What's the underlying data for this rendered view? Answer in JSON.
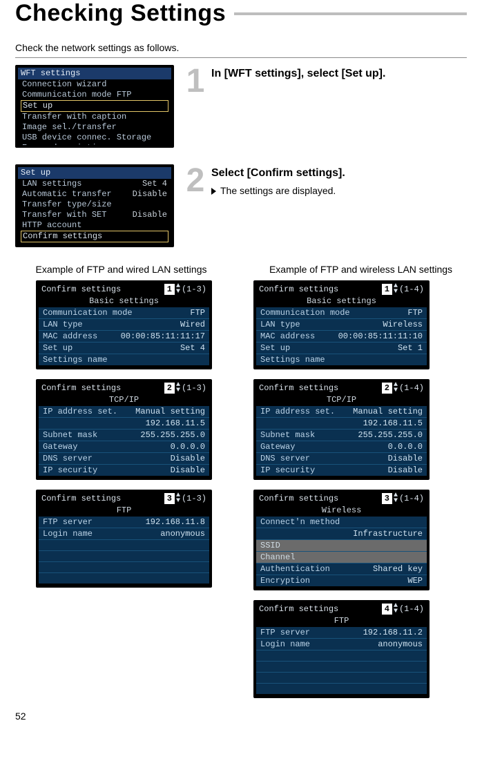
{
  "title": "Checking Settings",
  "intro": "Check the network settings as follows.",
  "page_number": "52",
  "step1": {
    "number": "1",
    "heading": "In [WFT settings], select [Set up].",
    "screen": {
      "header": "WFT settings",
      "rows": [
        "Connection wizard",
        "Communication mode FTP",
        "Set up",
        "Transfer with caption",
        "Image sel./transfer",
        "USB device connec. Storage",
        "Error description"
      ],
      "selected_index": 2,
      "muted_index": 6
    }
  },
  "step2": {
    "number": "2",
    "heading": "Select [Confirm settings].",
    "note": "The settings are displayed.",
    "screen": {
      "header": "Set up",
      "rows": [
        {
          "l": "LAN settings",
          "r": "Set 4"
        },
        {
          "l": "Automatic transfer",
          "r": "Disable"
        },
        {
          "l": "Transfer type/size",
          "r": ""
        },
        {
          "l": "Transfer with SET",
          "r": "Disable"
        },
        {
          "l": "HTTP account",
          "r": "",
          "muted": true
        },
        {
          "l": "Confirm settings",
          "r": "",
          "selected": true
        }
      ]
    }
  },
  "examples": {
    "wired_title": "Example of FTP and wired LAN settings",
    "wireless_title": "Example of FTP and wireless LAN settings",
    "wired": [
      {
        "title": "Confirm settings",
        "page": "1",
        "range": "(1-3)",
        "subtitle": "Basic settings",
        "rows": [
          {
            "l": "Communication mode",
            "r": "FTP"
          },
          {
            "l": "LAN type",
            "r": "Wired"
          },
          {
            "l": "MAC address",
            "r": "00:00:85:11:11:17"
          },
          {
            "l": "Set up",
            "r": "Set 4"
          },
          {
            "l": "Settings name",
            "r": ""
          }
        ],
        "pad": 0
      },
      {
        "title": "Confirm settings",
        "page": "2",
        "range": "(1-3)",
        "subtitle": "TCP/IP",
        "rows": [
          {
            "l": "IP address set.",
            "r": "Manual setting"
          },
          {
            "l": "_",
            "r": "192.168.11.5",
            "hide_label": true
          },
          {
            "l": "Subnet mask",
            "r": "255.255.255.0"
          },
          {
            "l": "Gateway",
            "r": "0.0.0.0"
          },
          {
            "l": "DNS server",
            "r": "Disable"
          },
          {
            "l": "IP security",
            "r": "Disable"
          }
        ],
        "pad": 0
      },
      {
        "title": "Confirm settings",
        "page": "3",
        "range": "(1-3)",
        "subtitle": "FTP",
        "rows": [
          {
            "l": "FTP server",
            "r": "192.168.11.8"
          },
          {
            "l": "Login name",
            "r": "anonymous"
          }
        ],
        "pad": 4
      }
    ],
    "wireless": [
      {
        "title": "Confirm settings",
        "page": "1",
        "range": "(1-4)",
        "subtitle": "Basic settings",
        "rows": [
          {
            "l": "Communication mode",
            "r": "FTP"
          },
          {
            "l": "LAN type",
            "r": "Wireless"
          },
          {
            "l": "MAC address",
            "r": "00:00:85:11:11:10"
          },
          {
            "l": "Set up",
            "r": "Set 1"
          },
          {
            "l": "Settings name",
            "r": ""
          }
        ],
        "pad": 0
      },
      {
        "title": "Confirm settings",
        "page": "2",
        "range": "(1-4)",
        "subtitle": "TCP/IP",
        "rows": [
          {
            "l": "IP address set.",
            "r": "Manual setting"
          },
          {
            "l": "_",
            "r": "192.168.11.5",
            "hide_label": true
          },
          {
            "l": "Subnet mask",
            "r": "255.255.255.0"
          },
          {
            "l": "Gateway",
            "r": "0.0.0.0"
          },
          {
            "l": "DNS server",
            "r": "Disable"
          },
          {
            "l": "IP security",
            "r": "Disable"
          }
        ],
        "pad": 0
      },
      {
        "title": "Confirm settings",
        "page": "3",
        "range": "(1-4)",
        "subtitle": "Wireless",
        "rows": [
          {
            "l": "Connect'n method",
            "r": ""
          },
          {
            "l": "_",
            "r": "Infrastructure",
            "hide_label": true
          },
          {
            "l": "SSID",
            "r": "",
            "grey": true
          },
          {
            "l": "Channel",
            "r": "",
            "grey": true
          },
          {
            "l": "Authentication",
            "r": "Shared key"
          },
          {
            "l": "Encryption",
            "r": "WEP"
          }
        ],
        "pad": 0
      },
      {
        "title": "Confirm settings",
        "page": "4",
        "range": "(1-4)",
        "subtitle": "FTP",
        "rows": [
          {
            "l": "FTP server",
            "r": "192.168.11.2"
          },
          {
            "l": "Login name",
            "r": "anonymous"
          }
        ],
        "pad": 4
      }
    ]
  }
}
